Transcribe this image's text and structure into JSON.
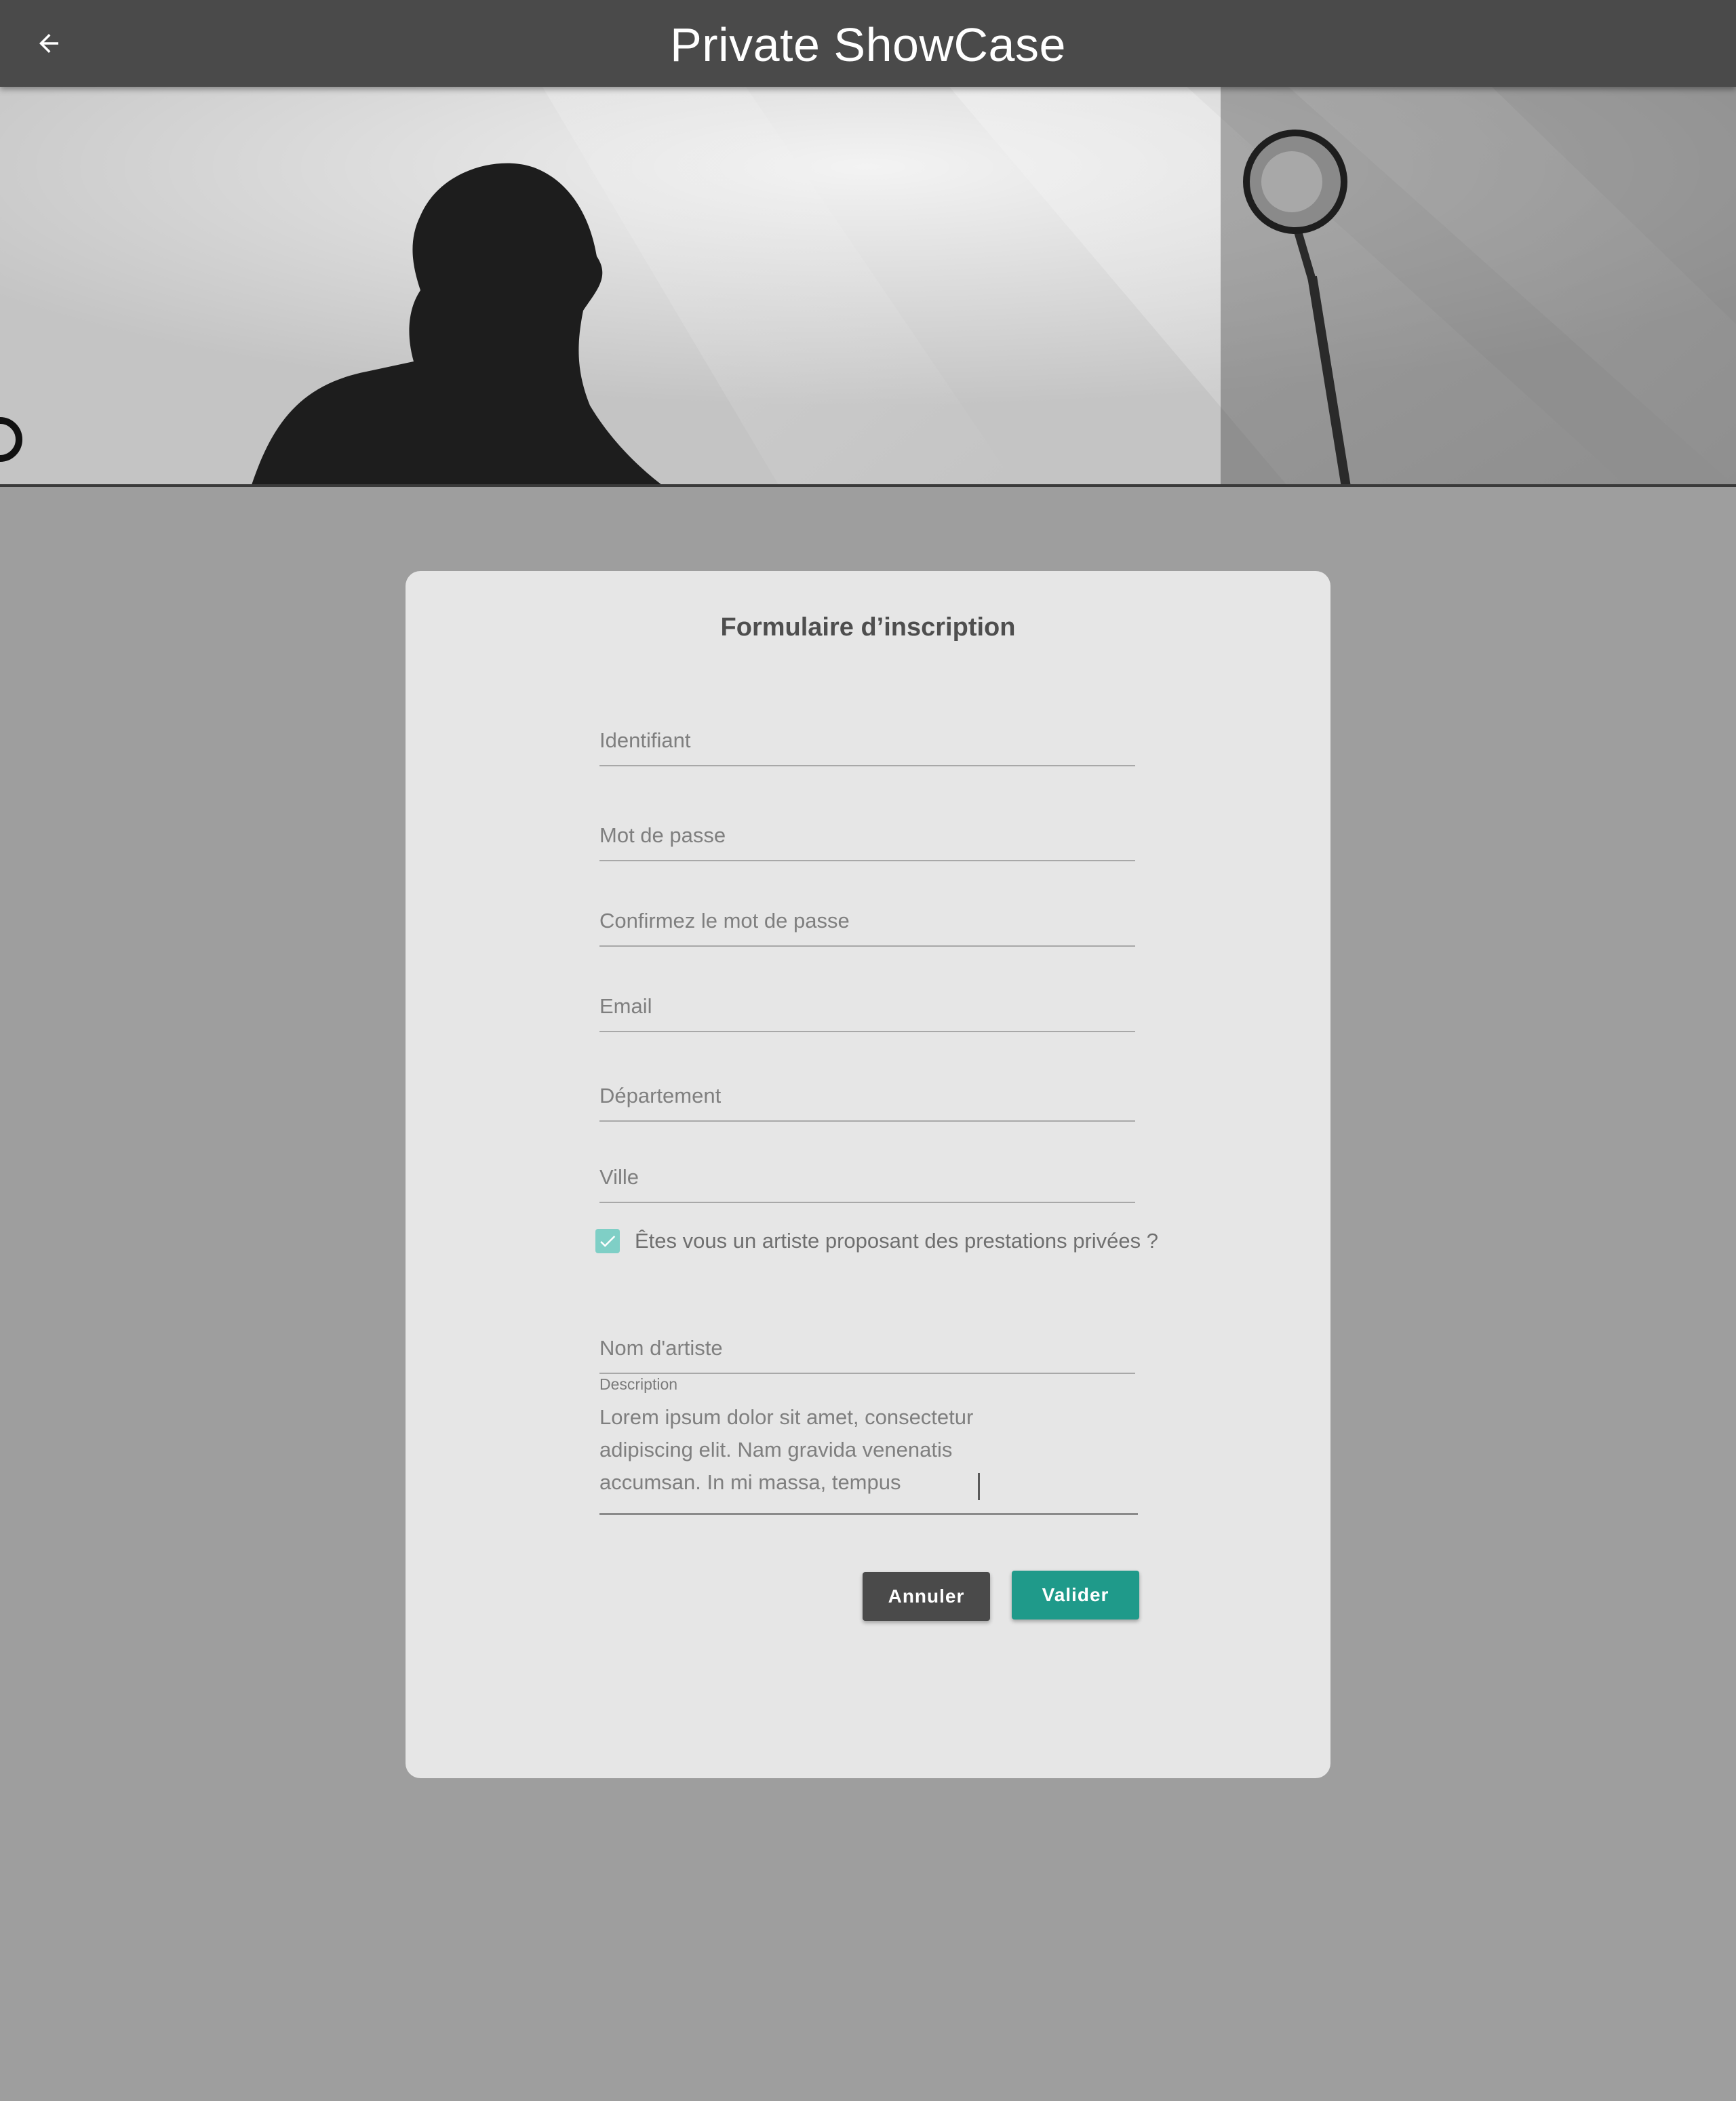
{
  "appbar": {
    "title": "Private ShowCase",
    "back_icon": "arrow-left-icon"
  },
  "hero": {
    "image": "black-and-white concert photo of singer and microphone"
  },
  "form": {
    "title": "Formulaire d’inscription",
    "fields": {
      "identifiant": "Identifiant",
      "mot_de_passe": "Mot de passe",
      "confirm_mot_de_passe": "Confirmez le mot de passe",
      "email": "Email",
      "departement": "Département",
      "ville": "Ville",
      "nom_artiste": "Nom d'artiste"
    },
    "artist_checkbox": {
      "label": "Êtes vous un artiste proposant des prestations privées ?",
      "checked": true
    },
    "description": {
      "label": "Description",
      "value": "Lorem ipsum dolor sit amet, consectetur adipiscing elit. Nam gravida venenatis accumsan. In mi massa, tempus"
    },
    "buttons": {
      "cancel": "Annuler",
      "submit": "Valider"
    }
  },
  "colors": {
    "appbar": "#4a4a4a",
    "background": "#9e9e9e",
    "card": "#e6e6e6",
    "accent": "#1f9a8a",
    "checkbox": "#7fcfc6"
  }
}
